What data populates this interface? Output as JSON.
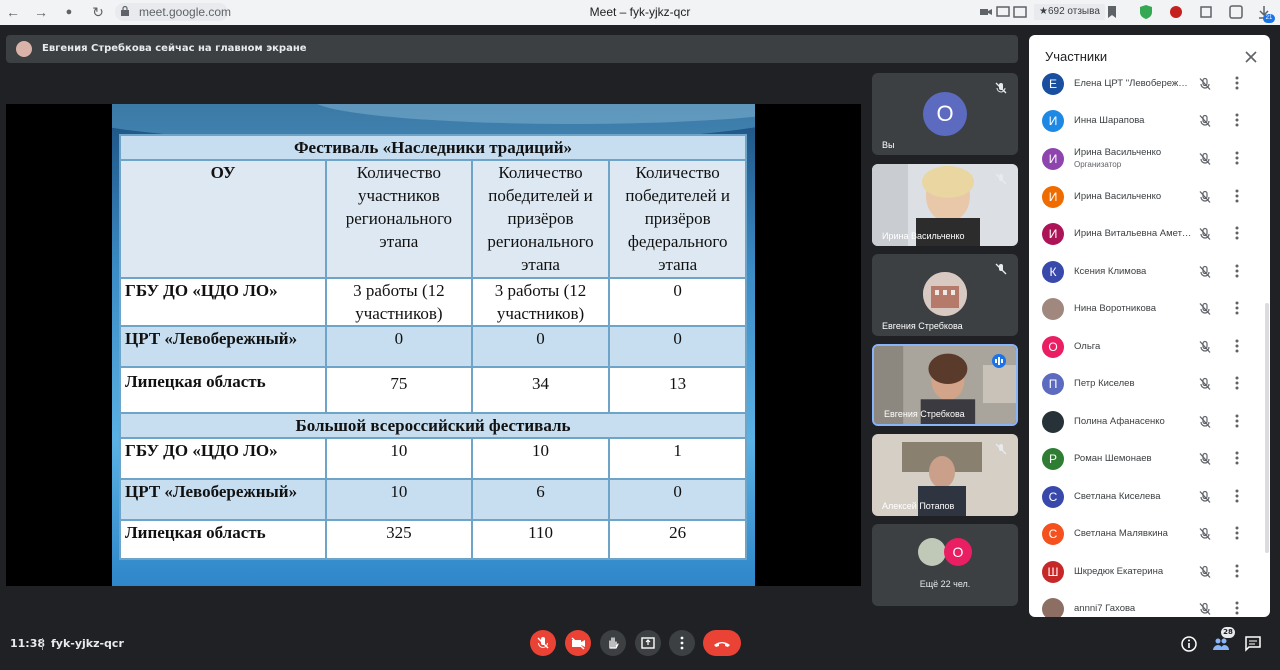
{
  "browser": {
    "url": "meet.google.com",
    "window_title": "Meet – fyk-yjkz-qcr",
    "reviews": "★692 отзыва",
    "download_badge": "21"
  },
  "banner": {
    "text": "Евгения Стребкова сейчас на главном экране"
  },
  "slide": {
    "title1": "Фестиваль «Наследники традиций»",
    "headers": [
      "ОУ",
      "Количество участников регионального этапа",
      "Количество победителей и призёров регионального этапа",
      "Количество победителей и призёров федерального этапа"
    ],
    "rows1": [
      [
        "ГБУ ДО «ЦДО ЛО»",
        "3 работы (12 участников)",
        "3 работы (12 участников)",
        "0"
      ],
      [
        "ЦРТ «Левобережный»",
        "0",
        "0",
        "0"
      ],
      [
        "Липецкая область",
        "75",
        "34",
        "13"
      ]
    ],
    "title2": "Большой всероссийский фестиваль",
    "rows2": [
      [
        "ГБУ ДО «ЦДО ЛО»",
        "10",
        "10",
        "1"
      ],
      [
        "ЦРТ «Левобережный»",
        "10",
        "6",
        "0"
      ],
      [
        "Липецкая область",
        "325",
        "110",
        "26"
      ]
    ]
  },
  "tiles": {
    "self_initial": "О",
    "self_name": "Вы",
    "t2_name": "Ирина Васильченко",
    "t3_name": "Евгения Стребкова",
    "t4_name": "Евгения Стребкова",
    "t5_name": "Алексей Потапов",
    "more_initial": "О",
    "more_label": "Ещё 22 чел."
  },
  "panel": {
    "title": "Участники",
    "participants": [
      {
        "initial": "Е",
        "name": "Елена ЦРТ \"Левобережный\"",
        "color": "#1a4e9e"
      },
      {
        "initial": "И",
        "name": "Инна Шарапова",
        "color": "#1e88e5"
      },
      {
        "initial": "И",
        "name": "Ирина Васильченко",
        "sub": "Организатор",
        "color": "#8e44ad"
      },
      {
        "initial": "И",
        "name": "Ирина Васильченко",
        "color": "#ef6c00"
      },
      {
        "initial": "И",
        "name": "Ирина Витальевна Аметова",
        "color": "#ad1457"
      },
      {
        "initial": "К",
        "name": "Ксения Климова",
        "color": "#3949ab"
      },
      {
        "initial": "",
        "name": "Нина Воротникова",
        "color": "#a1887f"
      },
      {
        "initial": "О",
        "name": "Ольга",
        "color": "#e91e63"
      },
      {
        "initial": "П",
        "name": "Петр Киселев",
        "color": "#5c6bc0"
      },
      {
        "initial": "",
        "name": "Полина Афанасенко",
        "color": "#263238"
      },
      {
        "initial": "Р",
        "name": "Роман Шемонаев",
        "color": "#2e7d32"
      },
      {
        "initial": "С",
        "name": "Светлана Киселева",
        "color": "#3949ab"
      },
      {
        "initial": "С",
        "name": "Светлана Малявкина",
        "color": "#f4511e"
      },
      {
        "initial": "Ш",
        "name": "Шкредюк Екатерина",
        "color": "#c62828"
      },
      {
        "initial": "",
        "name": "annni7 Гахова",
        "color": "#8d6e63"
      }
    ]
  },
  "bottom": {
    "time": "11:38",
    "code": "fyk-yjkz-qcr",
    "people_count": "28"
  },
  "colors": {
    "accent": "#8ab4f8",
    "danger": "#ea4335",
    "surface": "#3c4043",
    "background": "#202124"
  }
}
